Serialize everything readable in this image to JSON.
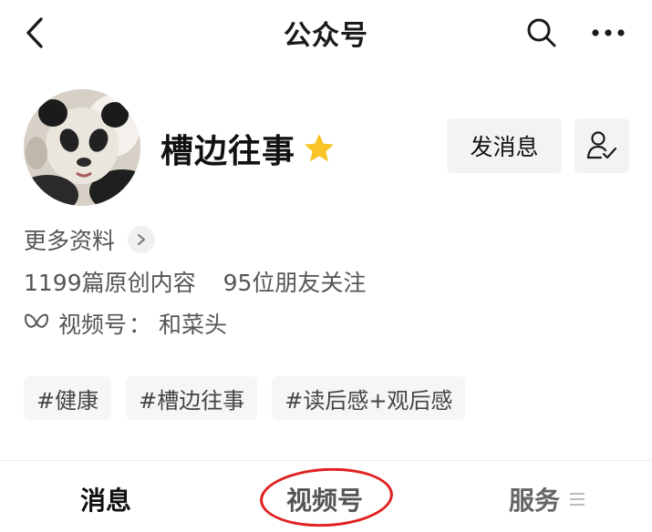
{
  "header": {
    "title": "公众号",
    "back_icon": "chevron-left-icon",
    "search_icon": "search-icon",
    "more_icon": "more-horizontal-icon"
  },
  "profile": {
    "avatar": "panda-avatar",
    "name": "槽边往事",
    "star_icon": "star-icon",
    "star_color": "#F7C325",
    "send_message_label": "发消息",
    "follow_icon": "user-check-icon",
    "more_info_label": "更多资料",
    "original_count_label": "1199篇原创内容",
    "friends_following_label": "95位朋友关注",
    "channel_prefix": "视频号",
    "channel_sep": "：",
    "channel_name": "和菜头"
  },
  "tags": [
    "#健康",
    "#槽边往事",
    "#读后感+观后感"
  ],
  "bottom_tabs": {
    "messages": "消息",
    "channel": "视频号",
    "services": "服务"
  },
  "colors": {
    "annotation_circle": "#E02020",
    "button_bg": "#F3F3F3"
  }
}
